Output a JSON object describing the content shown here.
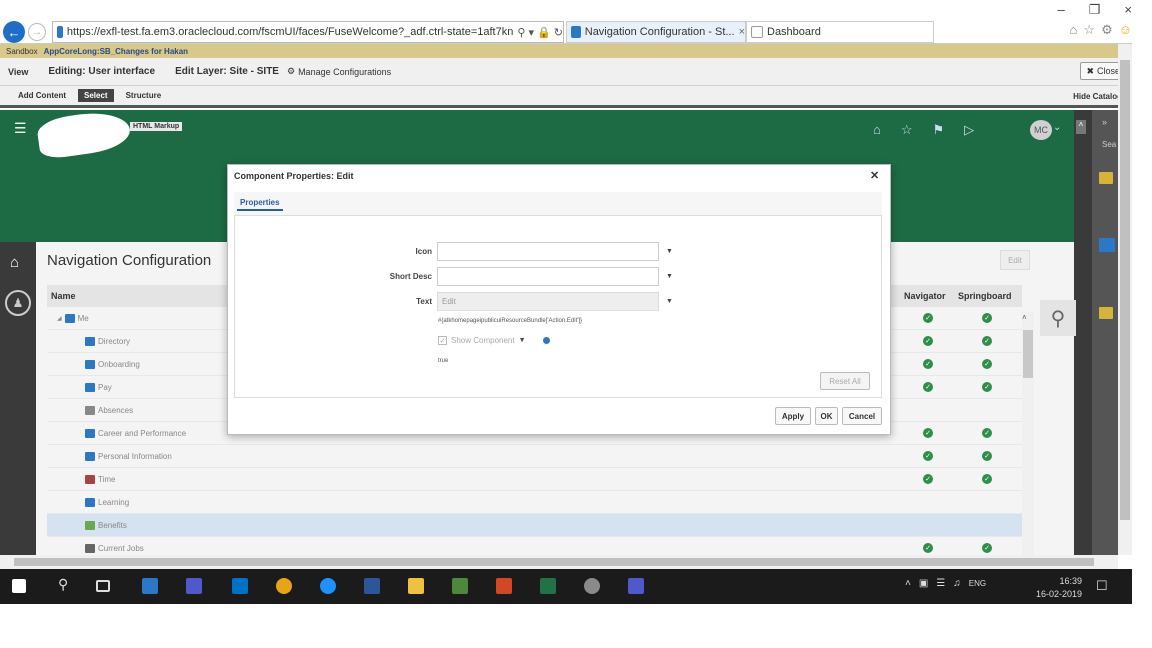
{
  "browser": {
    "url": "https://exfl-test.fa.em3.oraclecloud.com/fscmUI/faces/FuseWelcome?_adf.ctrl-state=1aft7kn",
    "tabs": [
      {
        "label": "Navigation Configuration - St...",
        "active": true
      },
      {
        "label": "Dashboard",
        "active": false
      }
    ]
  },
  "sandbox": {
    "label": "Sandbox",
    "name": "AppCoreLong:SB_Changes for Hakan"
  },
  "editbar": {
    "view": "View",
    "editing": "Editing: User interface",
    "layer": "Edit Layer: Site - SITE",
    "manage": "Manage Configurations",
    "close": "Close"
  },
  "designer_tabs": {
    "add_content": "Add Content",
    "select": "Select",
    "structure": "Structure",
    "hide_catalog": "Hide Catalog"
  },
  "header": {
    "html_markup": "HTML Markup",
    "avatar": "MC"
  },
  "right_panel": {
    "search_label": "Sea"
  },
  "page": {
    "title": "Navigation Configuration",
    "edit": "Edit",
    "columns": {
      "name": "Name",
      "navigator": "Navigator",
      "springboard": "Springboard"
    },
    "rows": [
      {
        "label": "Me",
        "nav": true,
        "spr": true,
        "color": "#2b78c8"
      },
      {
        "label": "Directory",
        "nav": true,
        "spr": true,
        "color": "#2b78c8"
      },
      {
        "label": "Onboarding",
        "nav": true,
        "spr": true,
        "color": "#2b78c8"
      },
      {
        "label": "Pay",
        "nav": true,
        "spr": true,
        "color": "#2b78c8"
      },
      {
        "label": "Absences",
        "nav": false,
        "spr": false,
        "color": "#888888"
      },
      {
        "label": "Career and Performance",
        "nav": true,
        "spr": true,
        "color": "#2b78c8"
      },
      {
        "label": "Personal Information",
        "nav": true,
        "spr": true,
        "color": "#2b78c8"
      },
      {
        "label": "Time",
        "nav": true,
        "spr": true,
        "color": "#aa4444"
      },
      {
        "label": "Learning",
        "nav": false,
        "spr": false,
        "color": "#2b78c8"
      },
      {
        "label": "Benefits",
        "nav": false,
        "spr": false,
        "color": "#6aa84f"
      },
      {
        "label": "Current Jobs",
        "nav": true,
        "spr": true,
        "color": "#666666"
      }
    ]
  },
  "modal": {
    "title": "Component Properties: Edit",
    "tab": "Properties",
    "fields": {
      "icon_label": "Icon",
      "icon_value": "",
      "short_desc_label": "Short Desc",
      "short_desc_value": "",
      "text_label": "Text",
      "text_value": "Edit"
    },
    "el_expression": "#{atkhomepageipublicuiResourceBundle['Action.Edit']}",
    "show_component": "Show Component",
    "true_value": "true",
    "reset_all": "Reset All",
    "apply": "Apply",
    "ok": "OK",
    "cancel": "Cancel"
  },
  "taskbar": {
    "language": "ENG",
    "time": "16:39",
    "date": "16-02-2019"
  }
}
